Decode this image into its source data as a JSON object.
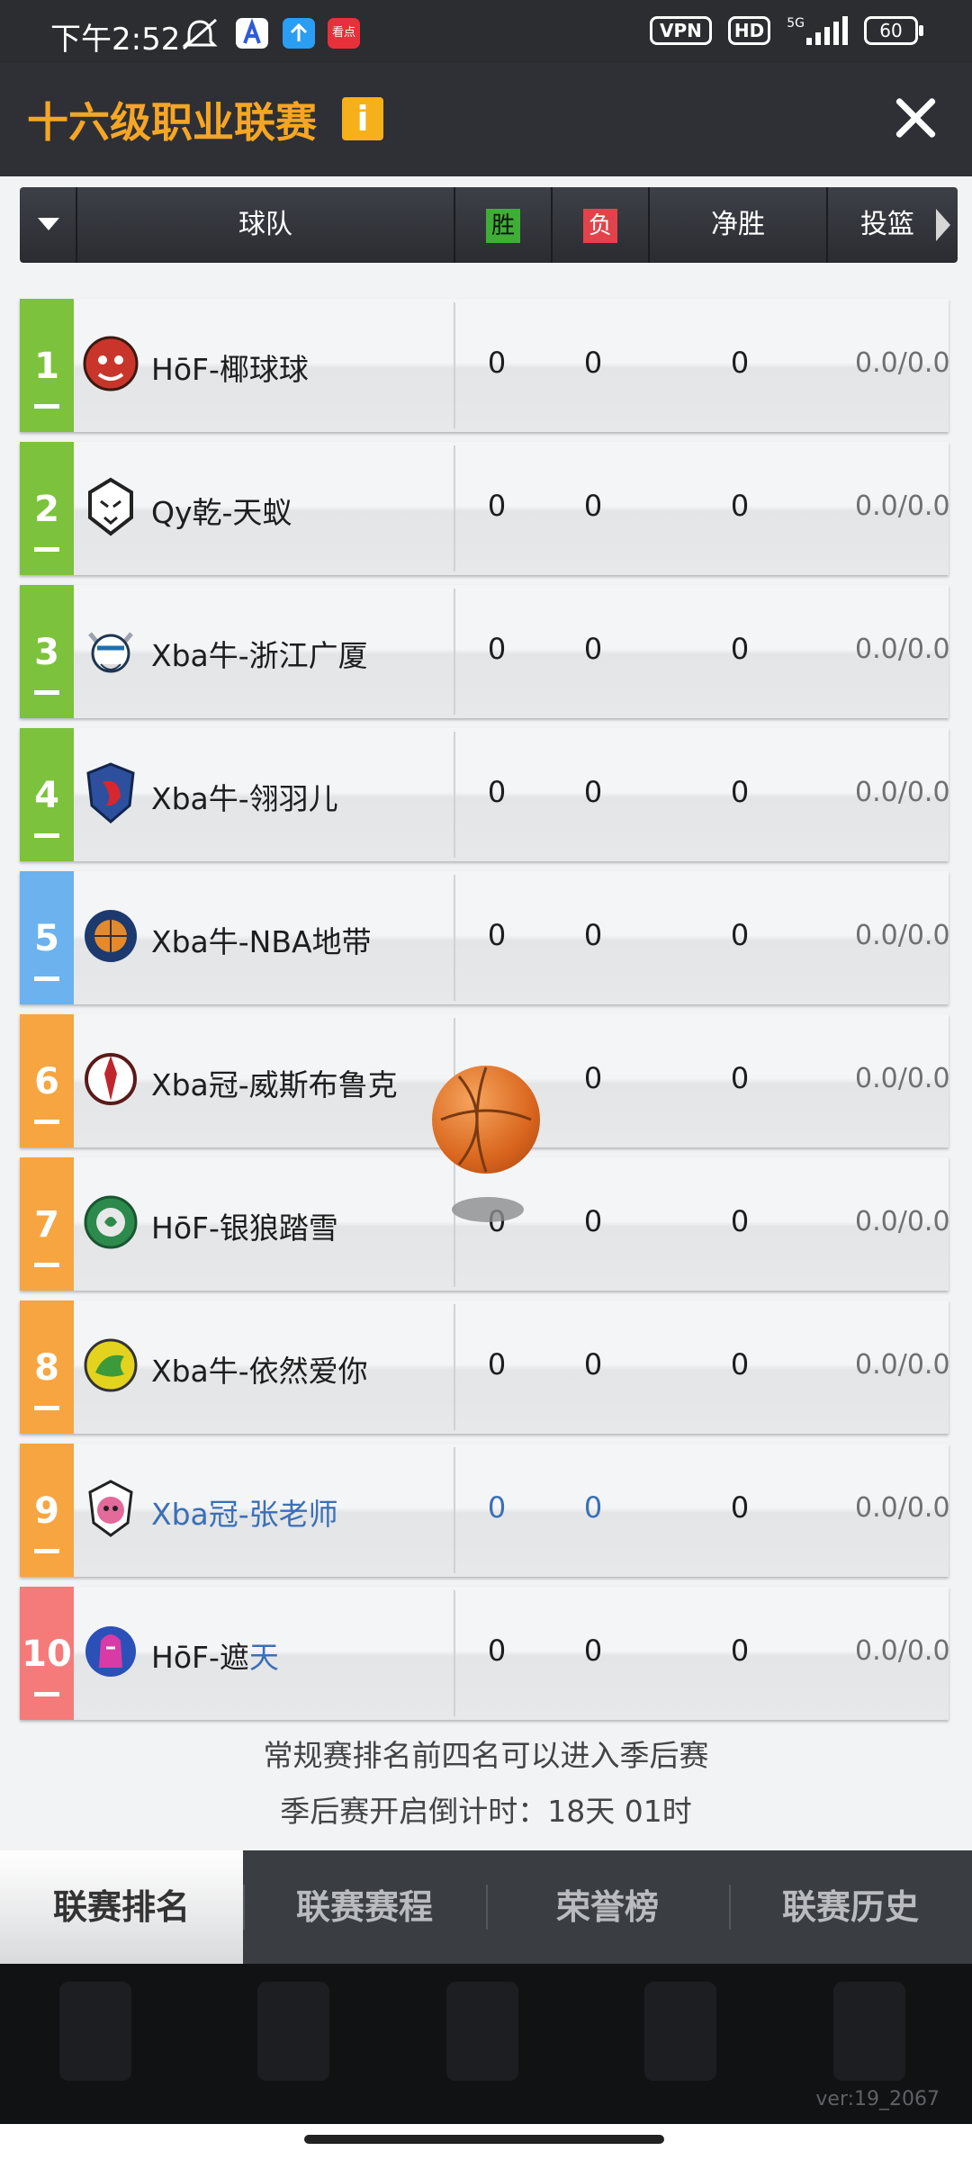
{
  "status_bar": {
    "time": "下午2:52",
    "vpn": "VPN",
    "hd": "HD",
    "network": "5G",
    "battery": "60",
    "app_badge": "看点"
  },
  "title_bar": {
    "title": "十六级职业联赛",
    "info_icon": "info-icon",
    "close_icon": "close-icon"
  },
  "table": {
    "headers": {
      "team": "球队",
      "wins": "胜",
      "losses": "负",
      "net": "净胜",
      "shooting": "投篮"
    },
    "rows": [
      {
        "rank": "1",
        "team": "HōF-椰球球",
        "wins": "0",
        "losses": "0",
        "net": "0",
        "shooting": "0.0/0.0",
        "rank_color": "#7dc23c",
        "logo": "tiger-logo-icon"
      },
      {
        "rank": "2",
        "team": "Qy乾-天蚁",
        "wins": "0",
        "losses": "0",
        "net": "0",
        "shooting": "0.0/0.0",
        "rank_color": "#7dc23c",
        "logo": "wolf-logo-icon"
      },
      {
        "rank": "3",
        "team": "Xba牛-浙江广厦",
        "wins": "0",
        "losses": "0",
        "net": "0",
        "shooting": "0.0/0.0",
        "rank_color": "#7dc23c",
        "logo": "viking-logo-icon"
      },
      {
        "rank": "4",
        "team": "Xba牛-翎羽儿",
        "wins": "0",
        "losses": "0",
        "net": "0",
        "shooting": "0.0/0.0",
        "rank_color": "#7dc23c",
        "logo": "bird-shield-logo-icon"
      },
      {
        "rank": "5",
        "team": "Xba牛-NBA地带",
        "wins": "0",
        "losses": "0",
        "net": "0",
        "shooting": "0.0/0.0",
        "rank_color": "#6bb2ef",
        "logo": "basketball-logo-icon"
      },
      {
        "rank": "6",
        "team": "Xba冠-威斯布鲁克",
        "wins": "",
        "losses": "0",
        "net": "0",
        "shooting": "0.0/0.0",
        "rank_color": "#f7a540",
        "logo": "warrior-logo-icon"
      },
      {
        "rank": "7",
        "team": "HōF-银狼踏雪",
        "wins": "0",
        "losses": "0",
        "net": "0",
        "shooting": "0.0/0.0",
        "rank_color": "#f7a540",
        "logo": "wreath-logo-icon"
      },
      {
        "rank": "8",
        "team": "Xba牛-依然爱你",
        "wins": "0",
        "losses": "0",
        "net": "0",
        "shooting": "0.0/0.0",
        "rank_color": "#f7a540",
        "logo": "dragon-logo-icon"
      },
      {
        "rank": "9",
        "team": "Xba冠-张老师",
        "wins": "0",
        "losses": "0",
        "net": "0",
        "shooting": "0.0/0.0",
        "rank_color": "#f7a540",
        "logo": "boar-logo-icon"
      },
      {
        "rank": "10",
        "team_prefix": "HōF-遮",
        "team_suffix": "天",
        "wins": "0",
        "losses": "0",
        "net": "0",
        "shooting": "0.0/0.0",
        "rank_color": "#f57b7b",
        "logo": "knight-logo-icon"
      }
    ]
  },
  "notes": {
    "line1": "常规赛排名前四名可以进入季后赛",
    "line2": "季后赛开启倒计时：18天 01时"
  },
  "tabs": [
    "联赛排名",
    "联赛赛程",
    "荣誉榜",
    "联赛历史"
  ],
  "version": "ver:19_2067"
}
